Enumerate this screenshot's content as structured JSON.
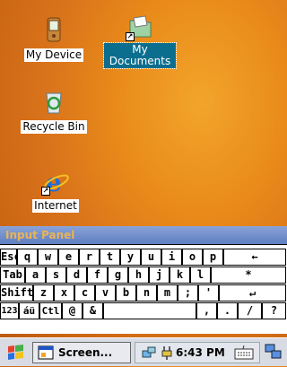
{
  "desktop": {
    "icons": [
      {
        "label": "My Device",
        "icon": "my-device-icon"
      },
      {
        "label": "My Documents",
        "icon": "folder-icon"
      },
      {
        "label": "Recycle Bin",
        "icon": "recycle-bin-icon"
      },
      {
        "label": "Internet",
        "icon": "internet-explorer-icon"
      }
    ]
  },
  "input_panel": {
    "title": "Input Panel",
    "rows": [
      [
        "Esc",
        "q",
        "w",
        "e",
        "r",
        "t",
        "y",
        "u",
        "i",
        "o",
        "p",
        "←"
      ],
      [
        "Tab",
        "a",
        "s",
        "d",
        "f",
        "g",
        "h",
        "j",
        "k",
        "l",
        "*"
      ],
      [
        "Shift",
        "z",
        "x",
        "c",
        "v",
        "b",
        "n",
        "m",
        ";",
        "'",
        "↵"
      ],
      [
        "123",
        "áü",
        "Ctl",
        "@",
        "&",
        " ",
        ",",
        ".",
        "/",
        "?"
      ]
    ]
  },
  "taskbar": {
    "start_icon": "windows-flag-icon",
    "task_label": "Screen...",
    "clock": "6:43 PM",
    "tray_icons": [
      "network-icon",
      "power-icon",
      "keyboard-icon",
      "connection-icon"
    ]
  },
  "colors": {
    "desktop": "#d9731b",
    "selection": "#0b6e8f",
    "panel_title": "#6f8fce"
  }
}
